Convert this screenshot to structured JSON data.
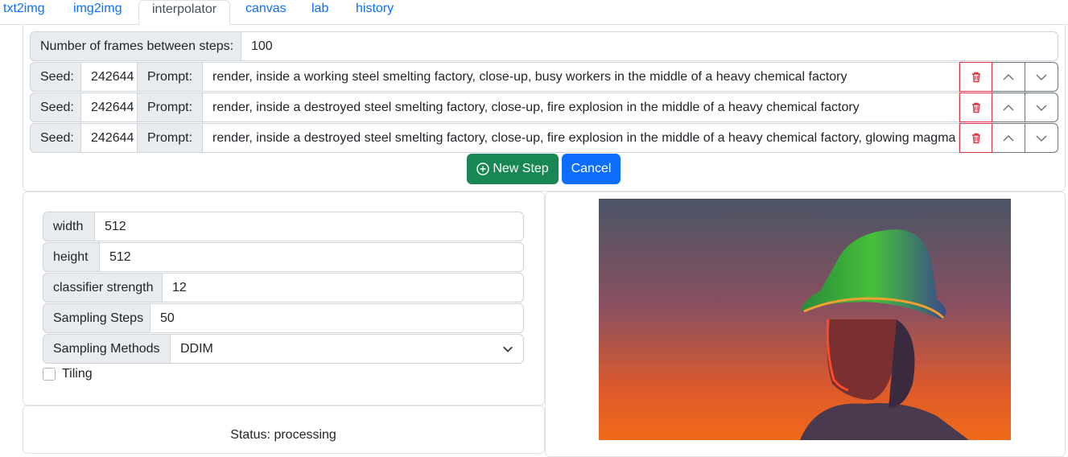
{
  "tabs": [
    {
      "label": "txt2img"
    },
    {
      "label": "img2img"
    },
    {
      "label": "interpolator"
    },
    {
      "label": "canvas"
    },
    {
      "label": "lab"
    },
    {
      "label": "history"
    }
  ],
  "active_tab": "interpolator",
  "frames": {
    "label": "Number of frames between steps:",
    "value": "100"
  },
  "steps": [
    {
      "seed_label": "Seed:",
      "seed": "242644",
      "prompt_label": "Prompt:",
      "prompt": "render, inside a working steel smelting factory, close-up, busy workers in the middle of a heavy chemical factory"
    },
    {
      "seed_label": "Seed:",
      "seed": "242644",
      "prompt_label": "Prompt:",
      "prompt": "render, inside a destroyed steel smelting factory, close-up, fire explosion in the middle of a heavy chemical factory"
    },
    {
      "seed_label": "Seed:",
      "seed": "242644",
      "prompt_label": "Prompt:",
      "prompt": "render, inside a destroyed steel smelting factory, close-up, fire explosion in the middle of a heavy chemical factory, glowing magma"
    }
  ],
  "buttons": {
    "new_step": "New Step",
    "cancel": "Cancel"
  },
  "settings": {
    "width": {
      "label": "width",
      "value": "512"
    },
    "height": {
      "label": "height",
      "value": "512"
    },
    "cfg": {
      "label": "classifier strength",
      "value": "12"
    },
    "steps": {
      "label": "Sampling Steps",
      "value": "50"
    },
    "method": {
      "label": "Sampling Methods",
      "value": "DDIM"
    },
    "tiling": {
      "label": "Tiling",
      "checked": false
    }
  },
  "status": "Status: processing",
  "colors": {
    "accent": "#0d6efd",
    "success": "#198754",
    "danger": "#dc3545"
  },
  "icons": [
    "trash-icon",
    "chevron-up-icon",
    "chevron-down-icon",
    "plus-circle-icon",
    "select-chevron-icon"
  ]
}
